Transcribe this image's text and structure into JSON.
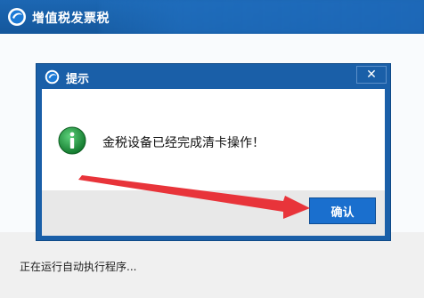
{
  "parent": {
    "title": "增值税发票税",
    "status": "正在运行自动执行程序..."
  },
  "dialog": {
    "title": "提示",
    "close_glyph": "✕",
    "message": "金税设备已经完成清卡操作！",
    "ok_label": "确认"
  },
  "colors": {
    "titlebar": "#1a5fa8",
    "ok_button": "#1a6fce",
    "arrow": "#e8343a",
    "info_icon": "#1f9a3e"
  },
  "icons": {
    "app": "app-logo-icon",
    "info": "info-icon",
    "close": "close-icon",
    "annotation": "red-arrow-icon"
  }
}
